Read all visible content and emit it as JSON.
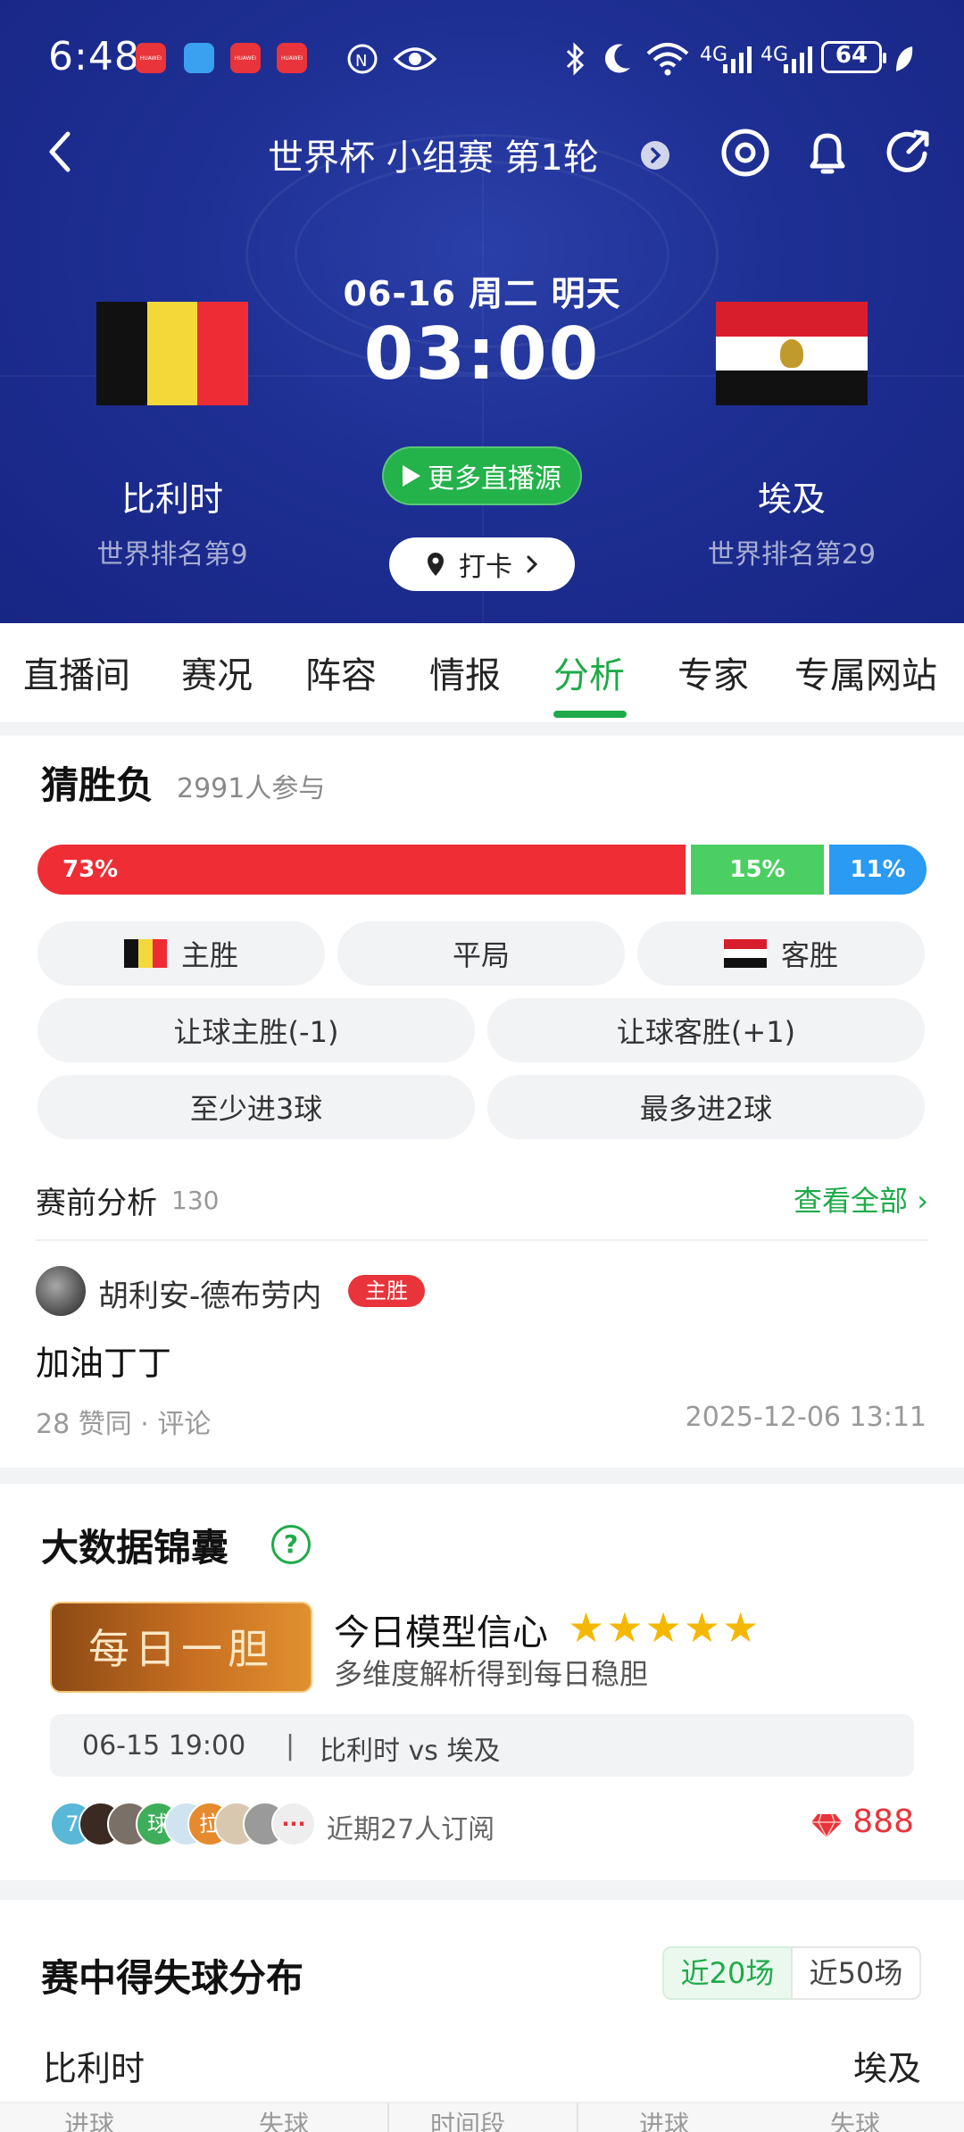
{
  "status_bar": {
    "time": "6:48",
    "app_badges": [
      "HUAWEI",
      "HUAWEI",
      "HUAWEI"
    ],
    "network1": "4G",
    "network2": "4G",
    "battery": "64"
  },
  "nav": {
    "title": "世界杯 小组赛 第1轮"
  },
  "match": {
    "date_caption": "06-16 周二 明天",
    "kickoff": "03:00",
    "home": {
      "name": "比利时",
      "rank": "世界排名第9"
    },
    "away": {
      "name": "埃及",
      "rank": "世界排名第29"
    },
    "live_button": "更多直播源",
    "checkin_button": "打卡"
  },
  "tabs": [
    "直播间",
    "赛况",
    "阵容",
    "情报",
    "分析",
    "专家",
    "专属网站"
  ],
  "active_tab": "分析",
  "predict": {
    "title": "猜胜负",
    "participants": "2991人参与",
    "bar": [
      {
        "label": "73%",
        "value": 73,
        "color": "#ef2d35"
      },
      {
        "label": "15%",
        "value": 15,
        "color": "#4ccf62"
      },
      {
        "label": "11%",
        "value": 11,
        "color": "#2a9af2"
      }
    ],
    "options": {
      "home_win": "主胜",
      "draw": "平局",
      "away_win": "客胜",
      "handicap_home": "让球主胜(-1)",
      "handicap_away": "让球客胜(+1)",
      "over": "至少进3球",
      "under": "最多进2球"
    }
  },
  "pre_analysis": {
    "label": "赛前分析",
    "count": "130",
    "view_all": "查看全部",
    "post": {
      "author": "胡利安-德布劳内",
      "badge": "主胜",
      "content": "加油丁丁",
      "meta": "28 赞同 · 评论",
      "date": "2025-12-06 13:11"
    }
  },
  "bigdata": {
    "title": "大数据锦囊",
    "help": "?",
    "daily_label": "每日一胆",
    "confidence_title": "今日模型信心",
    "stars": 5,
    "confidence_sub": "多维度解析得到每日稳胆",
    "match_time": "06-15 19:00",
    "separator": "|",
    "match_teams": "比利时 vs 埃及",
    "subscriber_avatars": [
      "7",
      "",
      "",
      "球",
      "",
      "拉",
      "",
      "",
      "···"
    ],
    "subscribers": "近期27人订阅",
    "price": "888"
  },
  "goals": {
    "title": "赛中得失球分布",
    "seg_20": "近20场",
    "seg_50": "近50场",
    "home": "比利时",
    "away": "埃及",
    "columns": [
      "进球",
      "失球",
      "时间段",
      "进球",
      "失球"
    ]
  },
  "colors": {
    "hero": "#1e2f93",
    "accent": "#1faa49",
    "red": "#e8343a",
    "belgium": [
      "#111111",
      "#f4d83a",
      "#ee2c36"
    ],
    "egypt": [
      "#d81e2c",
      "#ffffff",
      "#111111"
    ]
  }
}
